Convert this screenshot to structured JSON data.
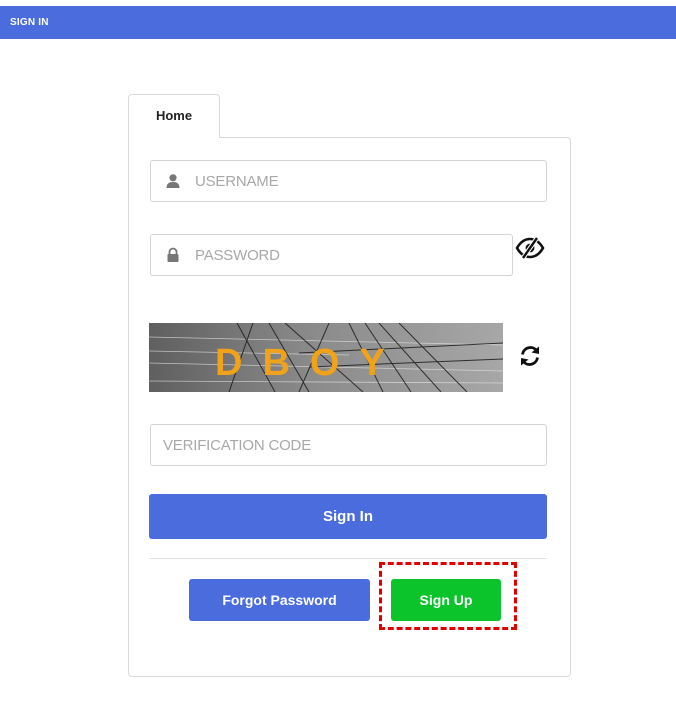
{
  "header": {
    "title": "SIGN IN",
    "background": "#4a6cdc"
  },
  "tabs": [
    {
      "label": "Home",
      "active": true
    }
  ],
  "form": {
    "username": {
      "placeholder": "USERNAME",
      "value": "",
      "icon": "user-icon"
    },
    "password": {
      "placeholder": "PASSWORD",
      "value": "",
      "icon": "lock-icon"
    },
    "password_toggle_icon": "eye-slash-icon",
    "captcha": {
      "text": "DBOY",
      "refresh_icon": "refresh-icon"
    },
    "verification": {
      "placeholder": "VERIFICATION CODE",
      "value": ""
    }
  },
  "buttons": {
    "sign_in": "Sign In",
    "forgot_password": "Forgot Password",
    "sign_up": "Sign Up"
  },
  "colors": {
    "primary": "#4a6cdc",
    "success": "#0bc42c",
    "highlight": "#e00000",
    "captcha_text": "#f0a21a"
  },
  "annotation": {
    "highlight_target": "sign-up-button",
    "style": "dashed-red-box"
  }
}
